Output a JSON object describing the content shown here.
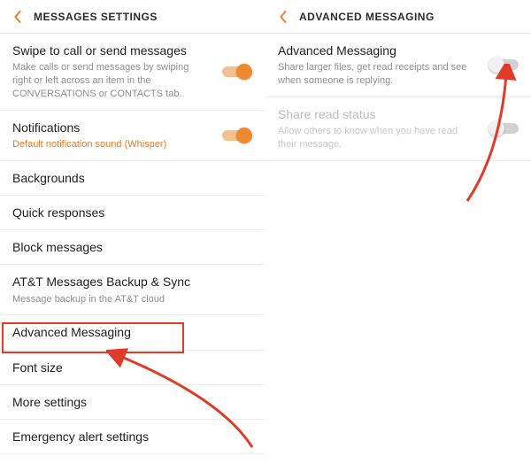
{
  "colors": {
    "accent": "#f0882e",
    "highlight": "#e03a2a"
  },
  "left": {
    "header_title": "MESSAGES SETTINGS",
    "items": [
      {
        "title": "Swipe to call or send messages",
        "sub": "Make calls or send messages by swiping right or left across an item in the CONVERSATIONS or CONTACTS tab.",
        "toggle": true
      },
      {
        "title": "Notifications",
        "sub": "Default notification sound (Whisper)",
        "sub_accent": true,
        "toggle": true
      },
      {
        "title": "Backgrounds"
      },
      {
        "title": "Quick responses"
      },
      {
        "title": "Block messages"
      },
      {
        "title": "AT&T Messages Backup & Sync",
        "sub": "Message backup in the AT&T cloud"
      },
      {
        "title": "Advanced Messaging",
        "highlight": true
      },
      {
        "title": "Font size"
      },
      {
        "title": "More settings"
      },
      {
        "title": "Emergency alert settings"
      }
    ]
  },
  "right": {
    "header_title": "ADVANCED MESSAGING",
    "items": [
      {
        "title": "Advanced Messaging",
        "sub": "Share larger files, get read receipts and see when someone is replying.",
        "toggle": false
      },
      {
        "title": "Share read status",
        "sub": "Allow others to know when you have read their message.",
        "toggle": false,
        "disabled": true
      }
    ]
  }
}
